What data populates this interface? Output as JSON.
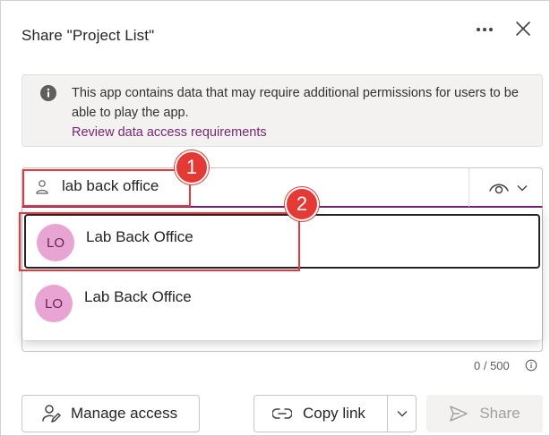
{
  "dialog": {
    "title": "Share \"Project List\"",
    "more_icon": "more-horizontal-icon",
    "close_icon": "close-icon"
  },
  "info": {
    "icon": "info-icon",
    "text": "This app contains data that may require additional permissions for users to be able to play the app.",
    "link": "Review data access requirements"
  },
  "people_picker": {
    "icon": "person-icon",
    "value": "lab back office",
    "permission_icon": "eye-icon",
    "permission_chevron": "chevron-down-icon"
  },
  "suggestions": [
    {
      "initials": "LO",
      "name": "Lab Back Office",
      "selected": true
    },
    {
      "initials": "LO",
      "name": "Lab Back Office",
      "selected": false
    }
  ],
  "message": {
    "counter": "0 / 500"
  },
  "footer": {
    "manage_access_label": "Manage access",
    "copy_link_label": "Copy link",
    "share_label": "Share"
  },
  "callouts": [
    {
      "number": "1"
    },
    {
      "number": "2"
    }
  ],
  "colors": {
    "accent": "#742774",
    "avatar_bg": "#e8a5d3",
    "callout": "#e53935"
  }
}
